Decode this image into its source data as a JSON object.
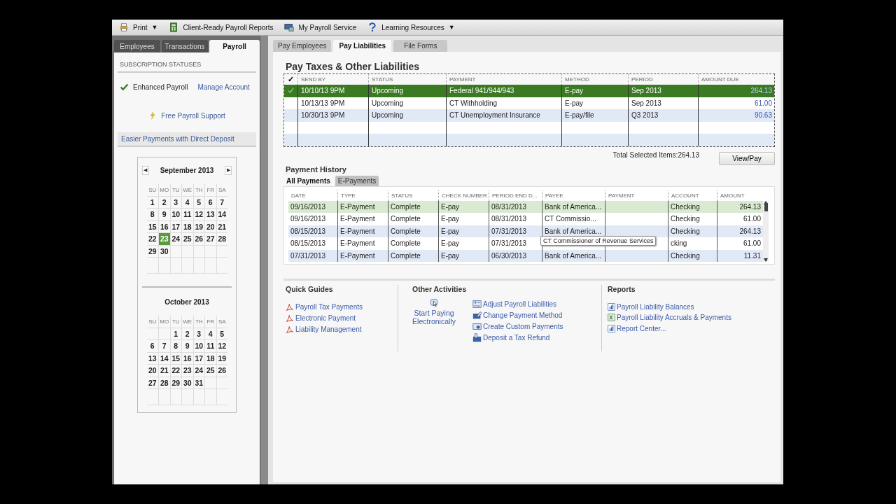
{
  "toolbar": [
    {
      "label": "Print",
      "caret": "▼"
    },
    {
      "label": "Client-Ready Payroll Reports"
    },
    {
      "label": "My Payroll Service"
    },
    {
      "label": "Learning Resources",
      "caret": "▼"
    }
  ],
  "left_tabs": [
    {
      "label": "Employees",
      "selected": false
    },
    {
      "label": "Transactions",
      "selected": false
    },
    {
      "label": "Payroll",
      "selected": true
    }
  ],
  "subscription": {
    "heading": "SUBSCRIPTION STATUSES",
    "status": "Enhanced Payroll",
    "manage_link": "Manage Account",
    "support_link": "Free Payroll Support",
    "direct_deposit": "Easier Payments with Direct Deposit"
  },
  "calendars": [
    {
      "month": "September 2013",
      "prev": "◀",
      "next": "▶",
      "weekdays": [
        "SU",
        "MO",
        "TU",
        "WE",
        "TH",
        "FR",
        "SA"
      ],
      "weeks": [
        {
          "days": [
            {
              "d": "1",
              "selected": false
            },
            {
              "d": "2",
              "selected": false
            },
            {
              "d": "3",
              "selected": false
            },
            {
              "d": "4",
              "selected": false
            },
            {
              "d": "5",
              "selected": false
            },
            {
              "d": "6",
              "selected": false
            },
            {
              "d": "7",
              "selected": false
            }
          ]
        },
        {
          "days": [
            {
              "d": "8",
              "selected": false
            },
            {
              "d": "9",
              "selected": false
            },
            {
              "d": "10",
              "selected": false
            },
            {
              "d": "11",
              "selected": false
            },
            {
              "d": "12",
              "selected": false
            },
            {
              "d": "13",
              "selected": false
            },
            {
              "d": "14",
              "selected": false
            }
          ]
        },
        {
          "days": [
            {
              "d": "15",
              "selected": false
            },
            {
              "d": "16",
              "selected": false
            },
            {
              "d": "17",
              "selected": false
            },
            {
              "d": "18",
              "selected": false
            },
            {
              "d": "19",
              "selected": false
            },
            {
              "d": "20",
              "selected": false
            },
            {
              "d": "21",
              "selected": false
            }
          ]
        },
        {
          "days": [
            {
              "d": "22",
              "selected": false
            },
            {
              "d": "23",
              "selected": true
            },
            {
              "d": "24",
              "selected": false
            },
            {
              "d": "25",
              "selected": false
            },
            {
              "d": "26",
              "selected": false
            },
            {
              "d": "27",
              "selected": false
            },
            {
              "d": "28",
              "selected": false
            }
          ]
        },
        {
          "days": [
            {
              "d": "29",
              "selected": false
            },
            {
              "d": "30",
              "selected": false
            }
          ]
        }
      ]
    },
    {
      "month": "October 2013",
      "weekdays": [
        "SU",
        "MO",
        "TU",
        "WE",
        "TH",
        "FR",
        "SA"
      ],
      "weeks": [
        {
          "days": [
            {
              "d": "1",
              "selected": false
            },
            {
              "d": "2",
              "selected": false
            },
            {
              "d": "3",
              "selected": false
            },
            {
              "d": "4",
              "selected": false
            },
            {
              "d": "5",
              "selected": false
            }
          ]
        },
        {
          "days": [
            {
              "d": "6",
              "selected": false
            },
            {
              "d": "7",
              "selected": false
            },
            {
              "d": "8",
              "selected": false
            },
            {
              "d": "9",
              "selected": false
            },
            {
              "d": "10",
              "selected": false
            },
            {
              "d": "11",
              "selected": false
            },
            {
              "d": "12",
              "selected": false
            }
          ]
        },
        {
          "days": [
            {
              "d": "13",
              "selected": false
            },
            {
              "d": "14",
              "selected": false
            },
            {
              "d": "15",
              "selected": false
            },
            {
              "d": "16",
              "selected": false
            },
            {
              "d": "17",
              "selected": false
            },
            {
              "d": "18",
              "selected": false
            },
            {
              "d": "19",
              "selected": false
            }
          ]
        },
        {
          "days": [
            {
              "d": "20",
              "selected": false
            },
            {
              "d": "21",
              "selected": false
            },
            {
              "d": "22",
              "selected": false
            },
            {
              "d": "23",
              "selected": false
            },
            {
              "d": "24",
              "selected": false
            },
            {
              "d": "25",
              "selected": false
            },
            {
              "d": "26",
              "selected": false
            }
          ]
        },
        {
          "days": [
            {
              "d": "27",
              "selected": false
            },
            {
              "d": "28",
              "selected": false
            },
            {
              "d": "29",
              "selected": false
            },
            {
              "d": "30",
              "selected": false
            },
            {
              "d": "31",
              "selected": false
            }
          ]
        }
      ]
    }
  ],
  "main_tabs": [
    {
      "label": "Pay Employees",
      "selected": false
    },
    {
      "label": "Pay Liabilities",
      "selected": true
    },
    {
      "label": "File Forms",
      "selected": false
    }
  ],
  "liabilities": {
    "title": "Pay Taxes & Other Liabilities",
    "check_header": "✓",
    "columns": [
      "SEND BY",
      "STATUS",
      "PAYMENT",
      "METHOD",
      "PERIOD",
      "AMOUNT DUE"
    ],
    "rows": [
      {
        "checked": true,
        "selected": true,
        "cells": [
          "10/10/13 9PM",
          "Upcoming",
          "Federal 941/944/943",
          "E-pay",
          "Sep 2013",
          "264.13"
        ]
      },
      {
        "checked": false,
        "selected": false,
        "cells": [
          "10/13/13 9PM",
          "Upcoming",
          "CT Withholding",
          "E-pay",
          "Sep 2013",
          "61.00"
        ]
      },
      {
        "checked": false,
        "selected": false,
        "cells": [
          "10/30/13 9PM",
          "Upcoming",
          "CT Unemployment Insurance",
          "E-pay/file",
          "Q3 2013",
          "90.63"
        ]
      }
    ],
    "total": "Total Selected Items:264.13",
    "button": "View/Pay"
  },
  "history": {
    "title": "Payment History",
    "tabs": [
      {
        "label": "All Payments",
        "selected": true
      },
      {
        "label": "E-Payments",
        "selected": false
      }
    ],
    "columns": [
      "DATE",
      "TYPE",
      "STATUS",
      "CHECK NUMBER",
      "PERIOD END D...",
      "PAYEE",
      "PAYMENT",
      "ACCOUNT",
      "AMOUNT"
    ],
    "rows": [
      {
        "selected": true,
        "cells": [
          "09/16/2013",
          "E-Payment",
          "Complete",
          "E-pay",
          "08/31/2013",
          "Bank of America...",
          "",
          "Checking",
          "264.13"
        ]
      },
      {
        "selected": false,
        "cells": [
          "09/16/2013",
          "E-Payment",
          "Complete",
          "E-pay",
          "08/31/2013",
          "CT Commissio...",
          "",
          "Checking",
          "61.00"
        ]
      },
      {
        "selected": false,
        "cells": [
          "08/15/2013",
          "E-Payment",
          "Complete",
          "E-pay",
          "07/31/2013",
          "Bank of America...",
          "",
          "Checking",
          "264.13"
        ]
      },
      {
        "selected": false,
        "cells": [
          "08/15/2013",
          "E-Payment",
          "Complete",
          "E-pay",
          "07/31/2013",
          "",
          "",
          "cking",
          "61.00"
        ]
      },
      {
        "selected": false,
        "cells": [
          "07/31/2013",
          "E-Payment",
          "Complete",
          "E-pay",
          "06/30/2013",
          "Bank of America...",
          "",
          "Checking",
          "11.31"
        ]
      }
    ],
    "tooltip": "CT Commissioner of Revenue Services"
  },
  "quick_guides": {
    "title": "Quick Guides",
    "links": [
      "Payroll Tax Payments",
      "Electronic Payment",
      "Liability Management"
    ]
  },
  "other_activities": {
    "title": "Other Activities",
    "start": "Start Paying Electronically",
    "links": [
      "Adjust Payroll Liabilities",
      "Change Payment Method",
      "Create Custom Payments",
      "Deposit a Tax Refund"
    ]
  },
  "reports": {
    "title": "Reports",
    "links": [
      "Payroll Liability Balances",
      "Payroll Liability Accruals & Payments",
      "Report Center..."
    ]
  }
}
